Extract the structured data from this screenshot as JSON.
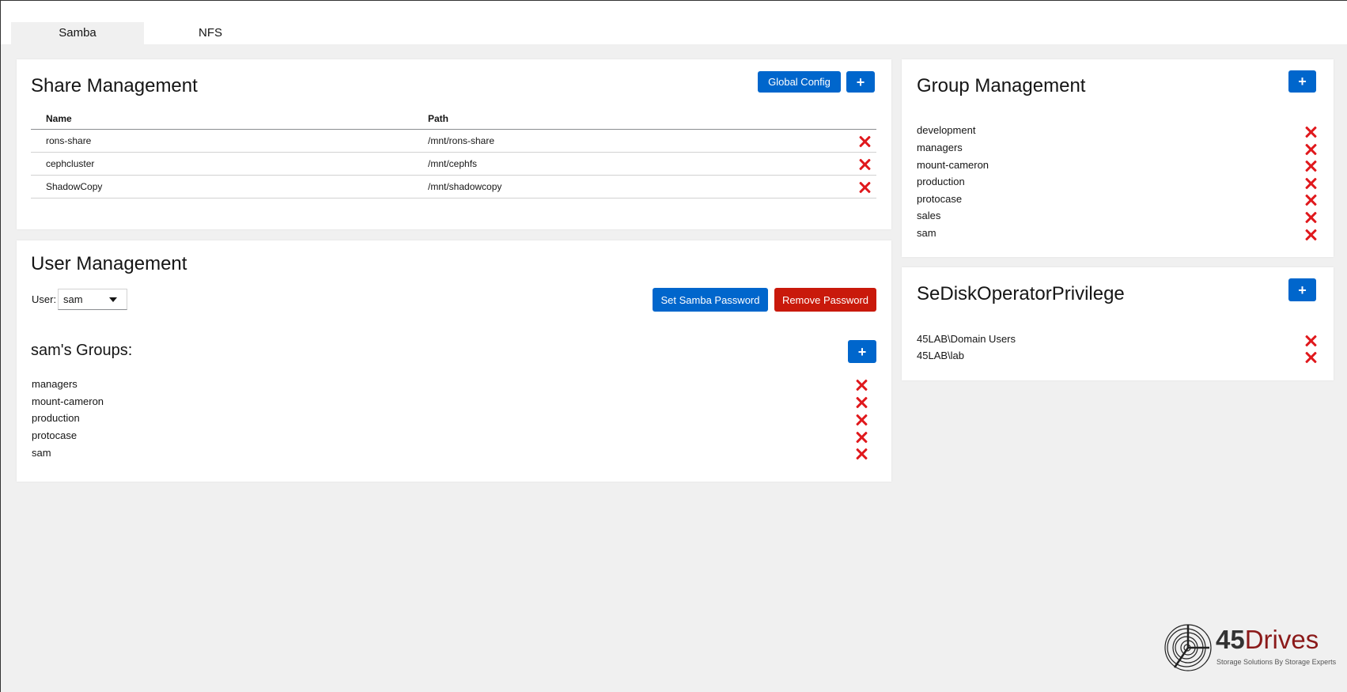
{
  "tabs": [
    {
      "label": "Samba",
      "active": true
    },
    {
      "label": "NFS",
      "active": false
    }
  ],
  "share_management": {
    "title": "Share Management",
    "global_config_label": "Global Config",
    "add_label": "+",
    "columns": [
      "Name",
      "Path"
    ],
    "rows": [
      {
        "name": "rons-share",
        "path": "/mnt/rons-share"
      },
      {
        "name": "cephcluster",
        "path": "/mnt/cephfs"
      },
      {
        "name": "ShadowCopy",
        "path": "/mnt/shadowcopy"
      }
    ]
  },
  "user_management": {
    "title": "User Management",
    "user_label": "User:",
    "selected_user": "sam",
    "set_password_label": "Set Samba Password",
    "remove_password_label": "Remove Password",
    "groups_title": "sam's Groups:",
    "add_label": "+",
    "groups": [
      "managers",
      "mount-cameron",
      "production",
      "protocase",
      "sam"
    ]
  },
  "group_management": {
    "title": "Group Management",
    "add_label": "+",
    "groups": [
      "development",
      "managers",
      "mount-cameron",
      "production",
      "protocase",
      "sales",
      "sam"
    ]
  },
  "privilege": {
    "title": "SeDiskOperatorPrivilege",
    "add_label": "+",
    "members": [
      "45LAB\\Domain Users",
      "45LAB\\lab"
    ]
  },
  "logo": {
    "number": "45",
    "word": "Drives",
    "tagline": "Storage Solutions By Storage Experts"
  },
  "colors": {
    "primary_blue": "#0066cc",
    "danger_red": "#c9190b",
    "delete_icon": "#e0191d",
    "background": "#f0f0f0"
  }
}
